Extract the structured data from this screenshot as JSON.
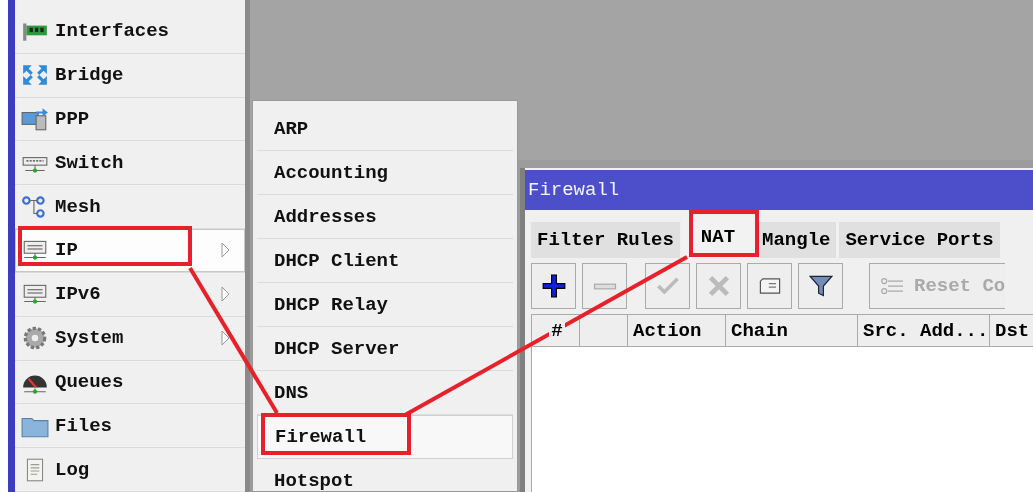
{
  "sidebar": {
    "items": [
      {
        "label": "Interfaces",
        "selected": false,
        "has_submenu": false
      },
      {
        "label": "Bridge",
        "selected": false,
        "has_submenu": false
      },
      {
        "label": "PPP",
        "selected": false,
        "has_submenu": false
      },
      {
        "label": "Switch",
        "selected": false,
        "has_submenu": false
      },
      {
        "label": "Mesh",
        "selected": false,
        "has_submenu": false
      },
      {
        "label": "IP",
        "selected": true,
        "has_submenu": true
      },
      {
        "label": "IPv6",
        "selected": false,
        "has_submenu": true
      },
      {
        "label": "System",
        "selected": false,
        "has_submenu": true
      },
      {
        "label": "Queues",
        "selected": false,
        "has_submenu": false
      },
      {
        "label": "Files",
        "selected": false,
        "has_submenu": false
      },
      {
        "label": "Log",
        "selected": false,
        "has_submenu": false
      }
    ]
  },
  "submenu": {
    "items": [
      {
        "label": "ARP",
        "selected": false
      },
      {
        "label": "Accounting",
        "selected": false
      },
      {
        "label": "Addresses",
        "selected": false
      },
      {
        "label": "DHCP Client",
        "selected": false
      },
      {
        "label": "DHCP Relay",
        "selected": false
      },
      {
        "label": "DHCP Server",
        "selected": false
      },
      {
        "label": "DNS",
        "selected": false
      },
      {
        "label": "Firewall",
        "selected": true
      },
      {
        "label": "Hotspot",
        "selected": false
      }
    ]
  },
  "window": {
    "title": "Firewall",
    "tabs": [
      {
        "label": "Filter Rules",
        "selected": false
      },
      {
        "label": "NAT",
        "selected": true
      },
      {
        "label": "Mangle",
        "selected": false
      },
      {
        "label": "Service Ports",
        "selected": false
      }
    ],
    "toolbar": [
      {
        "kind": "add",
        "disabled": false
      },
      {
        "kind": "remove",
        "disabled": true
      },
      {
        "kind": "enable",
        "disabled": true
      },
      {
        "kind": "disable",
        "disabled": true
      },
      {
        "kind": "comment",
        "disabled": false
      },
      {
        "kind": "filter",
        "disabled": false
      },
      {
        "kind": "reset",
        "label": "Reset Co",
        "disabled": true
      }
    ],
    "table": {
      "columns": [
        "#",
        "",
        "Action",
        "Chain",
        "Src. Add...",
        "Dst"
      ]
    }
  }
}
